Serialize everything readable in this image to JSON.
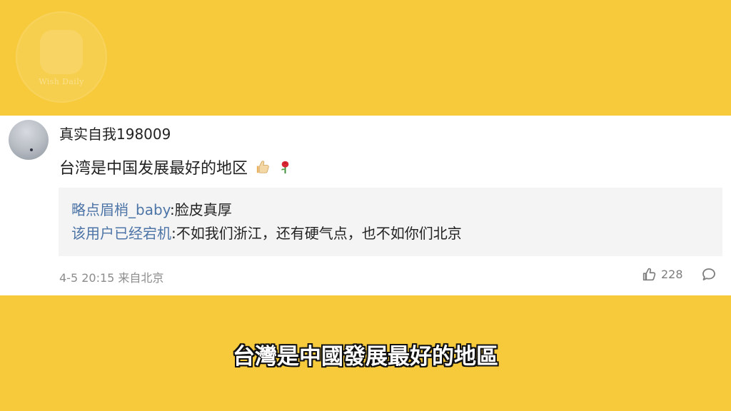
{
  "overlay": {
    "watermark_text": "Wish Daily"
  },
  "comment": {
    "username": "真实自我198009",
    "text": "台湾是中国发展最好的地区",
    "emoji_icons": [
      "thumbs-up-icon",
      "rose-icon"
    ],
    "replies": [
      {
        "user": "略点眉梢_baby",
        "text": ":脸皮真厚"
      },
      {
        "user": "该用户已经宕机",
        "text": ":不如我们浙江，还有硬气点，也不如你们北京"
      }
    ],
    "meta": "4-5 20:15 来自北京",
    "likes": "228",
    "actions": {
      "like_icon": "thumbs-up-icon",
      "reply_icon": "comment-icon"
    }
  },
  "subtitle": "台灣是中國發展最好的地區",
  "colors": {
    "background": "#f7ca3c",
    "card": "#ffffff",
    "reply_box": "#f4f4f5",
    "reply_user": "#4d74a6",
    "meta": "#8c8c8c",
    "subtitle_text": "#ffffff",
    "subtitle_outline": "#111111"
  }
}
